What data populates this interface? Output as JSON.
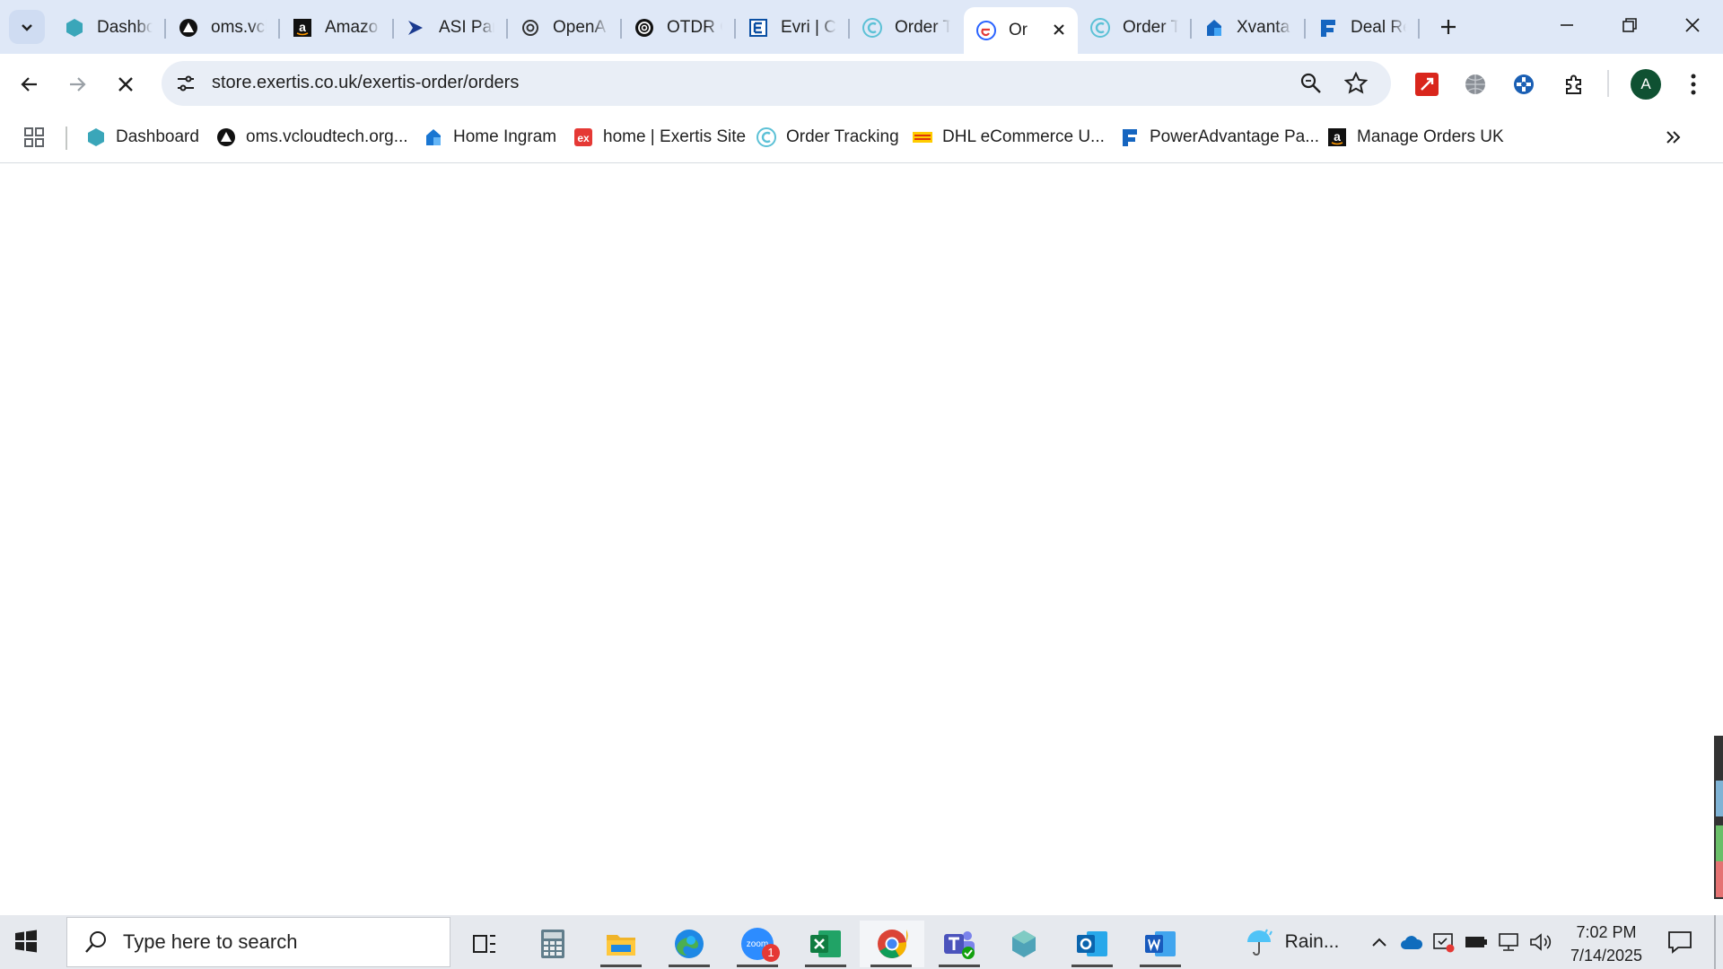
{
  "browser": {
    "tabs": [
      {
        "title": "Dashbo",
        "icon": "hex-teal-icon",
        "active": false
      },
      {
        "title": "oms.vcl",
        "icon": "triangle-black-icon",
        "active": false
      },
      {
        "title": "Amazo",
        "icon": "amazon-icon",
        "active": false
      },
      {
        "title": "ASI Par",
        "icon": "arrow-navy-icon",
        "active": false
      },
      {
        "title": "OpenA",
        "icon": "openai-icon",
        "active": false
      },
      {
        "title": "OTDR C",
        "icon": "openai-dark-icon",
        "active": false
      },
      {
        "title": "Evri | Cl",
        "icon": "evri-icon",
        "active": false
      },
      {
        "title": "Order T",
        "icon": "order-c-icon",
        "active": false
      },
      {
        "title": "Or",
        "icon": "exertis-e-icon",
        "active": true
      },
      {
        "title": "Order T",
        "icon": "order-c-icon",
        "active": false
      },
      {
        "title": "Xvanta",
        "icon": "xvantage-icon",
        "active": false
      },
      {
        "title": "Deal Re",
        "icon": "doc-blue-icon",
        "active": false
      }
    ],
    "address_bar": {
      "url": "store.exertis.co.uk/exertis-order/orders"
    },
    "bookmarks": [
      {
        "label": "Dashboard",
        "icon": "hex-teal-icon"
      },
      {
        "label": "oms.vcloudtech.org...",
        "icon": "triangle-black-icon"
      },
      {
        "label": "Home Ingram",
        "icon": "ingram-icon"
      },
      {
        "label": "home | Exertis Site",
        "icon": "exertis-ex-icon"
      },
      {
        "label": "Order Tracking",
        "icon": "order-c-icon"
      },
      {
        "label": "DHL eCommerce U...",
        "icon": "dhl-icon"
      },
      {
        "label": "PowerAdvantage Pa...",
        "icon": "doc-blue-icon"
      },
      {
        "label": "Manage Orders UK",
        "icon": "amazon-icon"
      }
    ],
    "profile_initial": "A"
  },
  "taskbar": {
    "search_placeholder": "Type here to search",
    "weather_text": "Rain...",
    "time": "7:02 PM",
    "date": "7/14/2025",
    "zoom_badge": "1"
  },
  "colors": {
    "chrome_bg": "#dfe8f7",
    "accent": "#0b57d0",
    "taskbar_bg": "#e6e9ee"
  }
}
